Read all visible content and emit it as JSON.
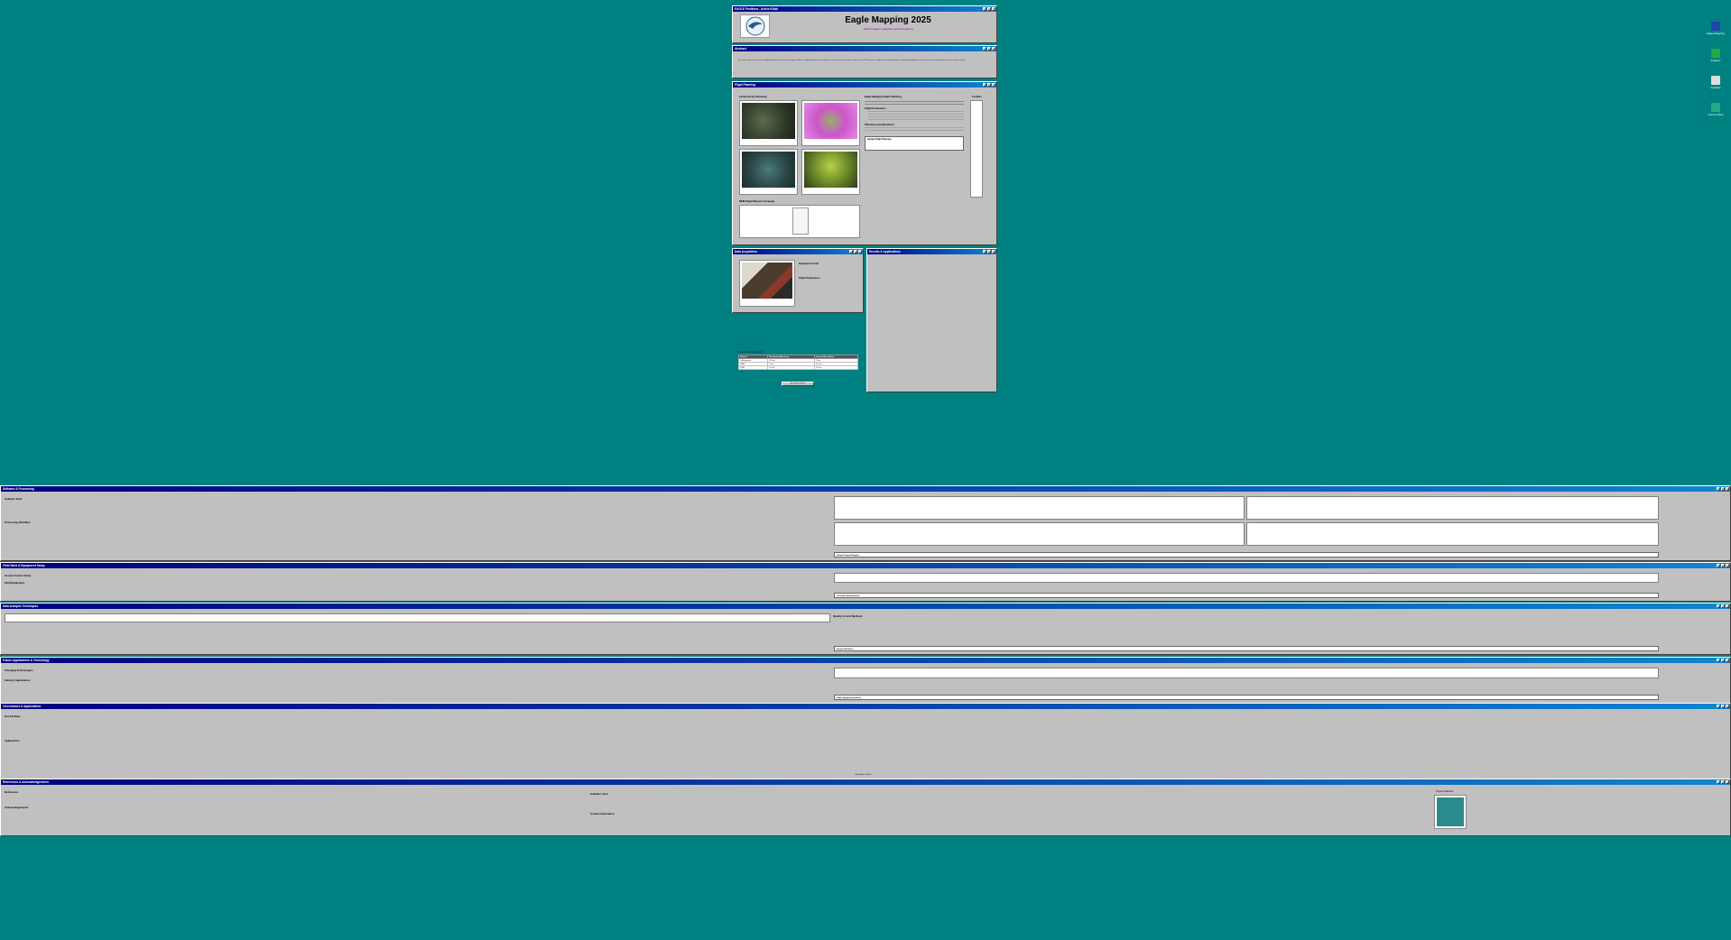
{
  "header_window": {
    "title": "EAGLE Positions - Active Killah",
    "heading": "Eagle Mapping 2025",
    "subtitle": "Aerial Imagery Collection and Processing"
  },
  "overview_window": {
    "title": "Abstract",
    "body": "This project documents aerial mapping collection and processing workflows, flight planning, data acquisition, data processing and results for the 2025 season. Imagery was collected with a fixed-wing platform and processed into orthomosaics and surface models."
  },
  "flight_window": {
    "title": "Flight Planning",
    "left_heading": "Aerial Survey Planning",
    "right_heading": "Eagle Mapping Flight Planning",
    "mission_heading": "Flight Parameters",
    "planning_heading": "Planning Considerations",
    "callout": "Sample Flight Planning",
    "toolbar_label": "Toolbox",
    "bottom_heading": "DEM Flight Mission Coverage"
  },
  "data_window": {
    "title": "Data Acquisition",
    "equipment_heading": "Equipment Used",
    "params_heading": "Flight Parameters",
    "table_heading": "Acquisition Summary",
    "table_headers": [
      "Dataset",
      "Resolution/Accuracy",
      "Ground Resolution"
    ],
    "table_rows": [
      [
        "Orthomosaic",
        "2.5 cm",
        "5 cm"
      ],
      [
        "DSM",
        "5 cm",
        "10 cm"
      ],
      [
        "DTM",
        "10 cm",
        "20 cm"
      ]
    ],
    "footer_button": "Acquisition Details"
  },
  "results_window": {
    "title": "Results & Applications"
  },
  "wide_windows": [
    {
      "title": "Software & Processing",
      "h1": "Software Suite",
      "h2": "Processing Workflow",
      "callout": "Sample Output Diagram"
    },
    {
      "title": "Field Work & Equipment Setup",
      "h1": "Ground Control Setup",
      "h2": "Field Equipment",
      "callout": "Technical Specifications"
    },
    {
      "title": "Data Analysis Techniques",
      "h1": "GCMP Data Classification",
      "h2": "Quality Control Methods",
      "callout": "Sample Workflow"
    },
    {
      "title": "Future Applications & Technology",
      "h1": "Emerging Technologies",
      "h2": "Industry Applications",
      "callout": "Eagle Mapping Innovation"
    },
    {
      "title": "Conclusions & Applications",
      "h1": "Key Findings",
      "h2": "Applications",
      "link": "Learn More Online"
    },
    {
      "title": "References & Acknowledgements",
      "h1": "References",
      "h2": "Acknowledgements",
      "h3": "Software Used",
      "h4": "Contact Information",
      "qr_label": "Project Website"
    }
  ],
  "desktop_icons": [
    {
      "label": "Eagle Mapping",
      "color": "#2244aa",
      "icon": "eagle-icon"
    },
    {
      "label": "Imagery",
      "color": "#22aa44",
      "icon": "imagery-icon"
    },
    {
      "label": "Analysis",
      "color": "#dddddd",
      "icon": "computer-icon"
    },
    {
      "label": "Internet Map",
      "color": "#22aa88",
      "icon": "globe-icon"
    }
  ]
}
